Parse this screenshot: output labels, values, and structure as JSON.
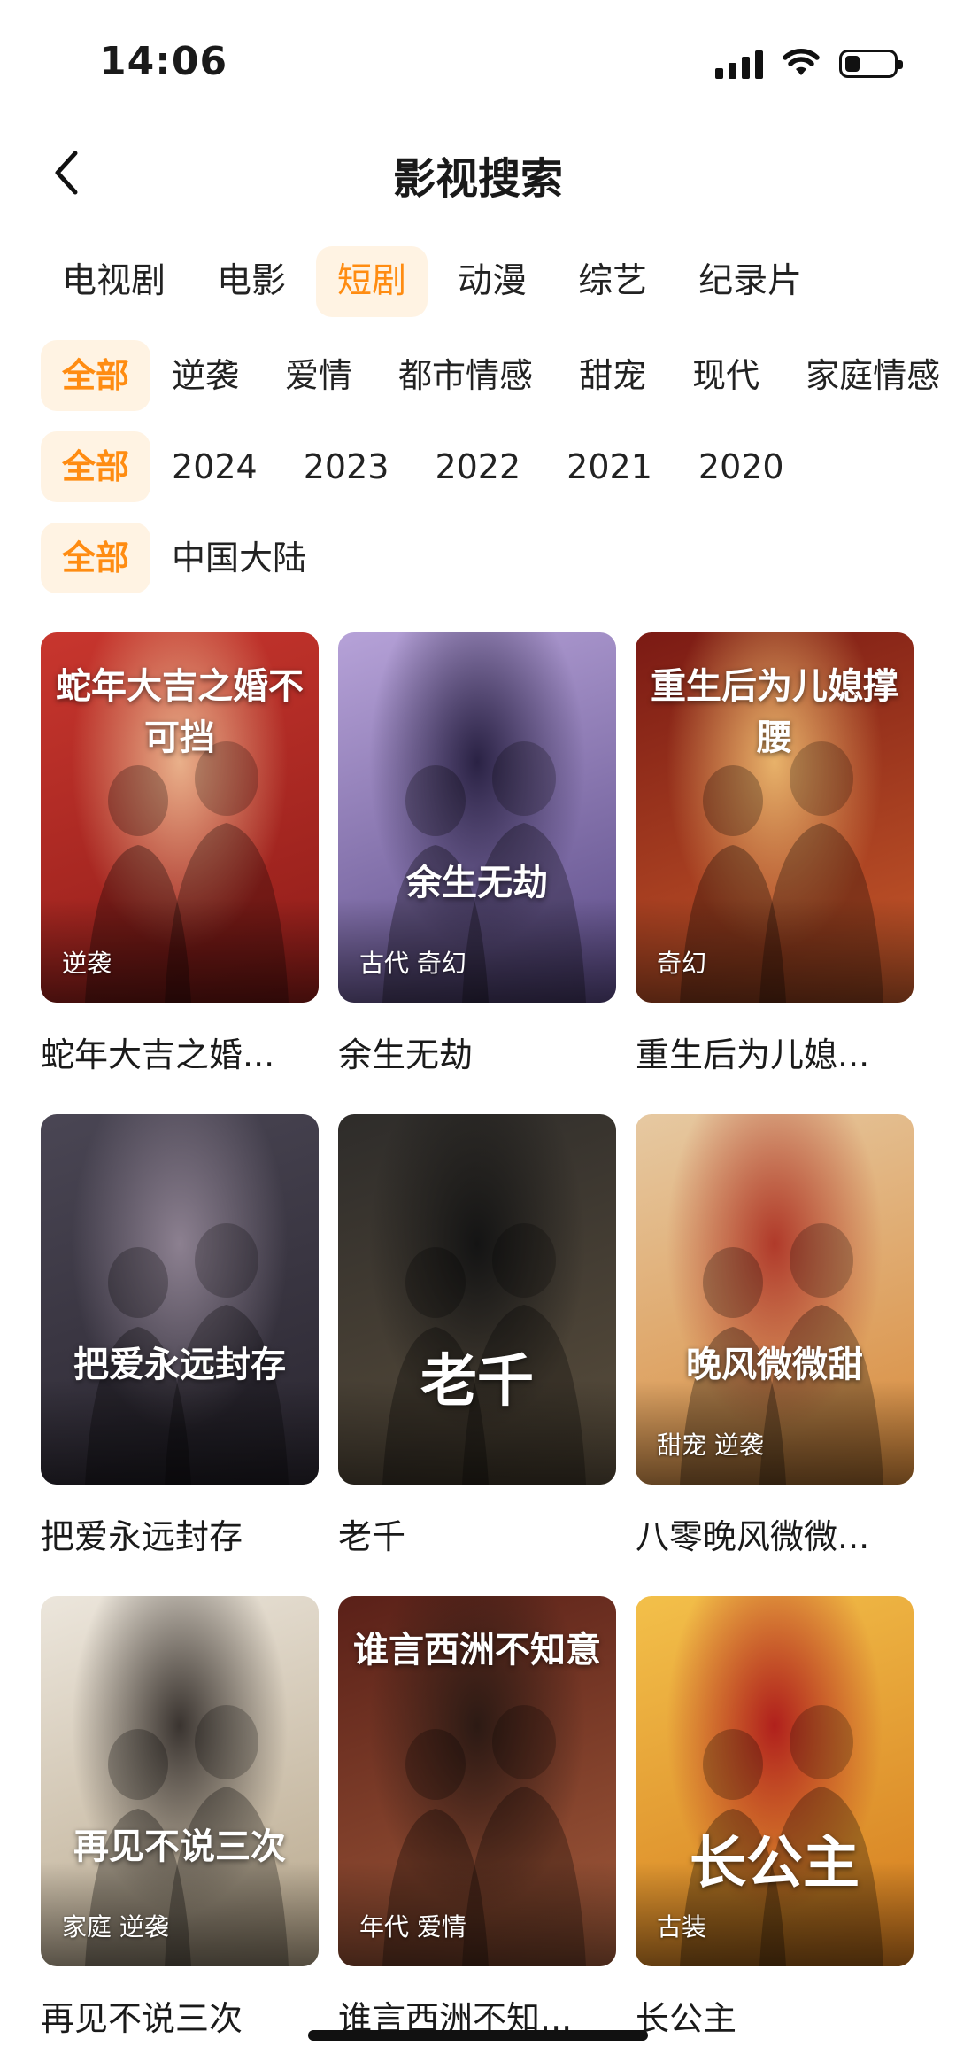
{
  "status_bar": {
    "time": "14:06",
    "battery_level": 0.3
  },
  "header": {
    "title": "影视搜索",
    "back_icon": "chevron-left-icon"
  },
  "tabs": [
    {
      "label": "电视剧",
      "active": false
    },
    {
      "label": "电影",
      "active": false
    },
    {
      "label": "短剧",
      "active": true
    },
    {
      "label": "动漫",
      "active": false
    },
    {
      "label": "综艺",
      "active": false
    },
    {
      "label": "纪录片",
      "active": false
    }
  ],
  "filters": {
    "genre": [
      "全部",
      "逆袭",
      "爱情",
      "都市情感",
      "甜宠",
      "现代",
      "家庭情感"
    ],
    "year": [
      "全部",
      "2024",
      "2023",
      "2022",
      "2021",
      "2020"
    ],
    "region": [
      "全部",
      "中国大陆"
    ]
  },
  "results": [
    {
      "title": "蛇年大吉之婚...",
      "tags": "逆袭",
      "art_text": "蛇年大吉之婚不可挡",
      "colors": [
        "#c8362e",
        "#8e1c18",
        "#e9b08a"
      ]
    },
    {
      "title": "余生无劫",
      "tags": "古代 奇幻",
      "art_text": "余生无劫",
      "colors": [
        "#b6a2d8",
        "#5a4a86",
        "#2a2244"
      ]
    },
    {
      "title": "重生后为儿媳...",
      "tags": "奇幻",
      "art_text": "重生后为儿媳撑腰",
      "colors": [
        "#7b1a14",
        "#c75a2a",
        "#e8b26a"
      ]
    },
    {
      "title": "把爱永远封存",
      "tags": "",
      "art_text": "把爱永远封存",
      "colors": [
        "#4a4654",
        "#2a2630",
        "#8c8090"
      ]
    },
    {
      "title": "老千",
      "tags": "",
      "art_text": "老千",
      "colors": [
        "#2e2c2a",
        "#5a4e3c",
        "#141414"
      ]
    },
    {
      "title": "八零晚风微微...",
      "tags": "甜宠 逆袭",
      "art_text": "晚风微微甜",
      "colors": [
        "#e6c9a2",
        "#d98a3a",
        "#b03a2a"
      ]
    },
    {
      "title": "再见不说三次",
      "tags": "家庭 逆袭",
      "art_text": "再见不说三次",
      "colors": [
        "#ece6dc",
        "#b7a68a",
        "#3a3430"
      ]
    },
    {
      "title": "谁言西洲不知...",
      "tags": "年代 爱情",
      "art_text": "谁言西洲不知意",
      "colors": [
        "#5a2018",
        "#a05a3a",
        "#2c1a14"
      ]
    },
    {
      "title": "长公主",
      "tags": "古装",
      "art_text": "长公主",
      "colors": [
        "#f3c04a",
        "#d47a1e",
        "#b0201c"
      ]
    }
  ]
}
